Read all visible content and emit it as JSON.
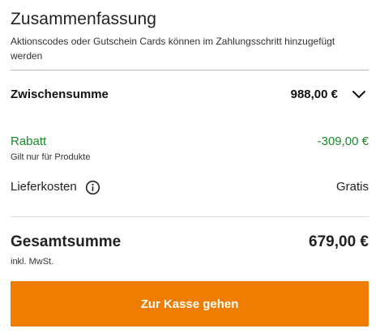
{
  "summary": {
    "title": "Zusammenfassung",
    "hint": "Aktionscodes oder Gutschein Cards können im Zahlungsschritt hinzugefügt werden"
  },
  "subtotal": {
    "label": "Zwischensumme",
    "value": "988,00 €",
    "toggle_icon": "chevron-down-icon"
  },
  "discount": {
    "label": "Rabatt",
    "note": "Gilt nur für Produkte",
    "value": "-309,00 €",
    "color": "#1a8a2a"
  },
  "shipping": {
    "label": "Lieferkosten",
    "info_icon": "info-icon",
    "value": "Gratis"
  },
  "total": {
    "label": "Gesamtsumme",
    "note": "inkl. MwSt.",
    "value": "679,00 €"
  },
  "checkout": {
    "label": "Zur Kasse gehen",
    "color": "#ef7d00"
  }
}
